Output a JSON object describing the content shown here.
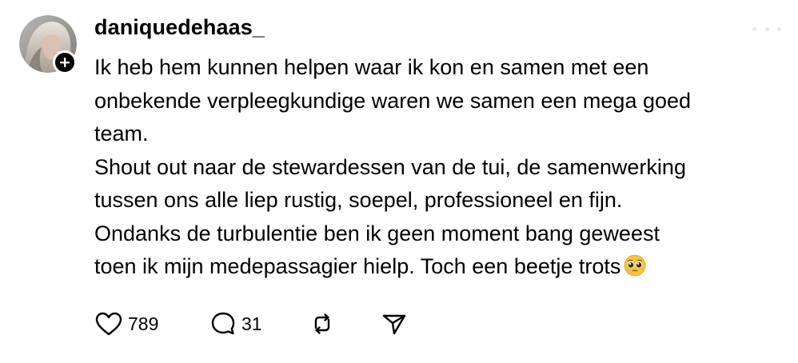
{
  "post": {
    "username": "daniquedehaas_",
    "lines": [
      "Ik heb hem kunnen helpen waar ik kon en samen met een",
      "onbekende verpleegkundige waren we samen een mega goed",
      "team.",
      "Shout out naar de stewardessen van de tui, de samenwerking",
      "tussen ons alle liep rustig, soepel, professioneel en fijn.",
      "Ondanks de turbulentie ben ik geen moment bang geweest",
      "toen ik mijn medepassagier hielp. Toch een beetje trots"
    ],
    "emoji": "pleading-face-emoji"
  },
  "actions": {
    "likes": "789",
    "replies": "31",
    "like_icon": "heart-icon",
    "reply_icon": "speech-bubble-icon",
    "repost_icon": "repost-icon",
    "share_icon": "send-icon"
  },
  "colors": {
    "text": "#000000",
    "background": "#ffffff",
    "emoji": "#f5c33b"
  }
}
